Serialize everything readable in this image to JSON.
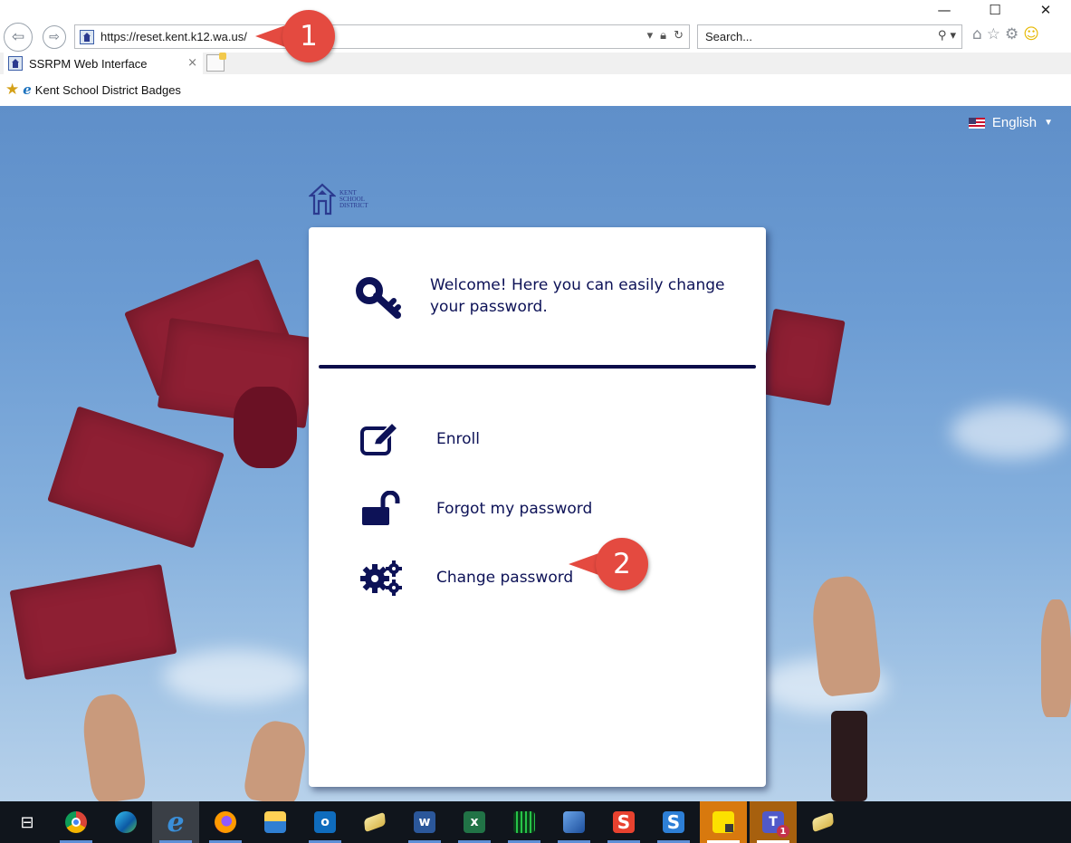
{
  "browser": {
    "window_controls": {
      "minimize": "—",
      "maximize": "☐",
      "close": "✕"
    },
    "address": {
      "url": "https://reset.kent.k12.wa.us/"
    },
    "search": {
      "placeholder": "Search..."
    },
    "tab": {
      "title": "SSRPM Web Interface",
      "close": "×"
    },
    "favorites": {
      "item_label": "Kent School District Badges"
    }
  },
  "page": {
    "language": "English",
    "logo_text": [
      "KENT",
      "SCHOOL",
      "DISTRICT"
    ],
    "welcome": "Welcome! Here you can easily change your password.",
    "menu": [
      {
        "label": "Enroll",
        "icon": "edit-icon"
      },
      {
        "label": "Forgot my password",
        "icon": "unlock-icon"
      },
      {
        "label": "Change password",
        "icon": "gears-icon"
      }
    ],
    "accent_color": "#0d1257",
    "callout_color": "#e44a40"
  },
  "annotations": {
    "callout_1": "1",
    "callout_2": "2"
  },
  "taskbar": {
    "items": [
      "task-view",
      "chrome",
      "edge",
      "internet-explorer",
      "firefox",
      "file-explorer",
      "outlook",
      "eraser-app",
      "word",
      "excel",
      "server-app",
      "remote-app",
      "snagit",
      "snagit-editor",
      "sticky-notes",
      "teams",
      "eraser-app-2"
    ],
    "teams_badge": "1"
  }
}
